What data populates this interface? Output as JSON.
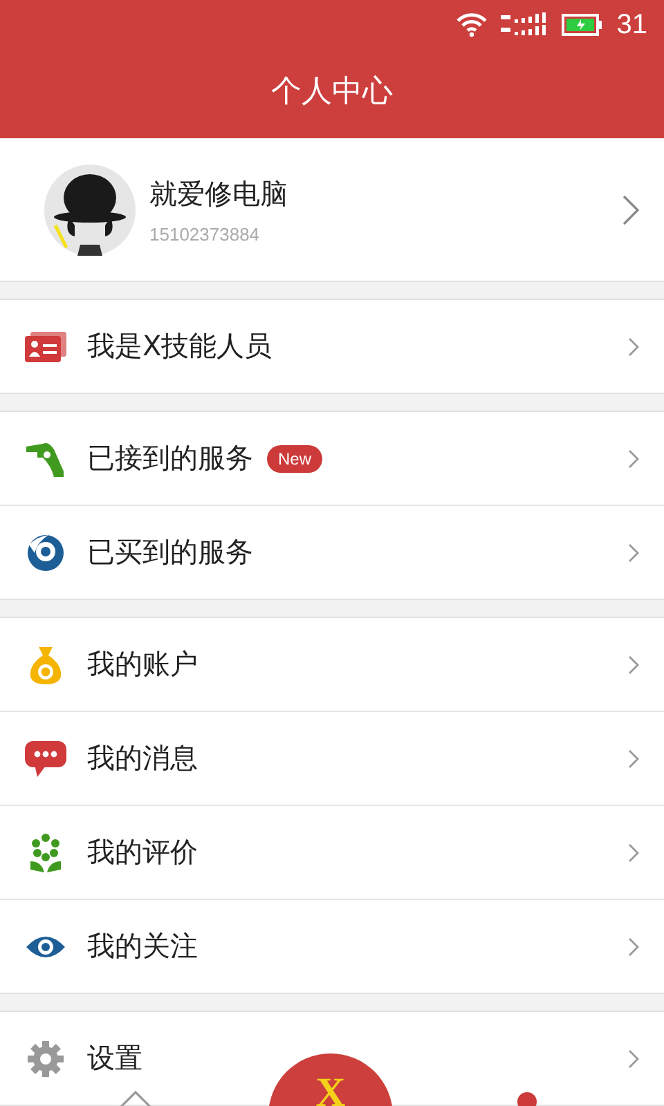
{
  "status_bar": {
    "time": "31"
  },
  "header": {
    "title": "个人中心"
  },
  "profile": {
    "name": "就爱修电脑",
    "phone": "15102373884"
  },
  "groups": [
    {
      "items": [
        {
          "label": "我是X技能人员"
        }
      ]
    },
    {
      "items": [
        {
          "label": "已接到的服务",
          "badge": "New"
        },
        {
          "label": "已买到的服务"
        }
      ]
    },
    {
      "items": [
        {
          "label": "我的账户"
        },
        {
          "label": "我的消息"
        },
        {
          "label": "我的评价"
        },
        {
          "label": "我的关注"
        }
      ]
    },
    {
      "items": [
        {
          "label": "设置"
        }
      ]
    }
  ],
  "bottom_nav": {
    "center_label": "X"
  }
}
